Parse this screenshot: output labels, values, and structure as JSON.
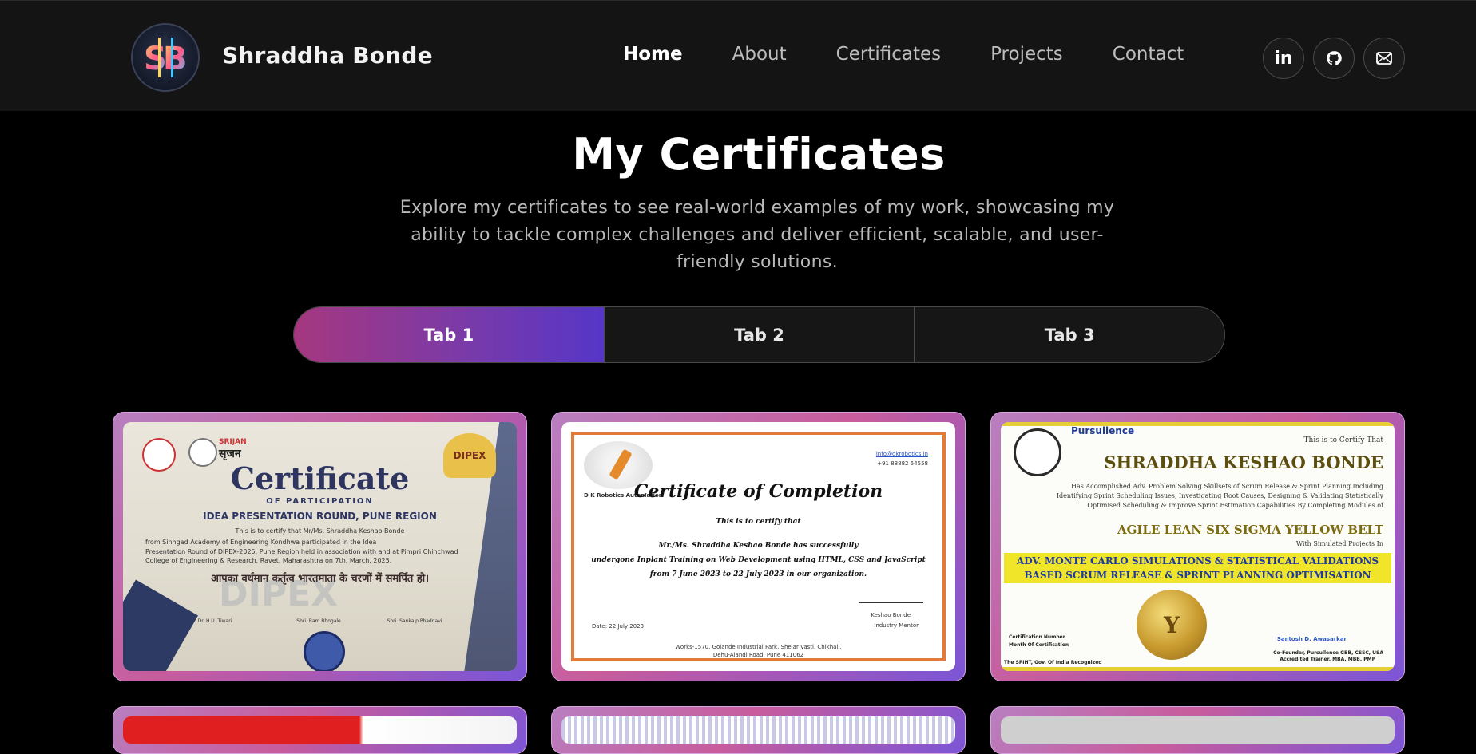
{
  "header": {
    "brand": "Shraddha Bonde",
    "logo_initials": "SB",
    "nav": [
      {
        "label": "Home",
        "active": true
      },
      {
        "label": "About",
        "active": false
      },
      {
        "label": "Certificates",
        "active": false
      },
      {
        "label": "Projects",
        "active": false
      },
      {
        "label": "Contact",
        "active": false
      }
    ],
    "social": [
      {
        "icon": "linkedin-icon",
        "glyph": "in"
      },
      {
        "icon": "github-icon"
      },
      {
        "icon": "mail-icon"
      }
    ]
  },
  "hero": {
    "title": "My Certificates",
    "description": "Explore my certificates to see real-world examples of my work, showcasing my ability to tackle complex challenges and deliver efficient, scalable, and user-friendly solutions."
  },
  "tabs": [
    {
      "label": "Tab 1",
      "active": true
    },
    {
      "label": "Tab 2",
      "active": false
    },
    {
      "label": "Tab 3",
      "active": false
    }
  ],
  "certificates": [
    {
      "heading": "Certificate",
      "subheading": "OF PARTICIPATION",
      "event": "IDEA PRESENTATION ROUND, PUNE REGION",
      "brand_left": "SRIJAN",
      "brand_left_hindi": "सृजन",
      "brand_right": "DIPEX",
      "recipient_line": "This is to certify that Mr/Ms.  Shraddha Keshao Bonde",
      "college_line": "from  Sinhgad Academy of Engineering Kondhwa  participated in the Idea",
      "detail_line1": "Presentation Round of DIPEX-2025, Pune Region held in association with and at Pimpri Chinchwad",
      "detail_line2": "College of Engineering & Research, Ravet, Maharashtra on 7th, March, 2025.",
      "hindi": "आपका वर्धमान कर्तृत्व भारतमाता के चरणों में समर्पित हो।",
      "watermark": "DIPEX",
      "signatories": [
        "Dr. H.U. Tiwari",
        "Shri. Ram Bhogale",
        "Shri. Sankalp Phadnavi"
      ]
    },
    {
      "heading": "Certificate of Completion",
      "intro": "This is to certify that",
      "body1": "Mr./Ms.  Shraddha Keshao Bonde  has successfully",
      "body2": "undergone Inplant Training on Web Development using HTML, CSS and JavaScript",
      "body3": "from 7 June 2023 to 22 July 2023 in our organization.",
      "company": "D K Robotics Automation",
      "email": "info@dkrobotics.in",
      "phone": "+91 88882 54558",
      "date": "Date: 22 July 2023",
      "signer": "Keshao Bonde",
      "signer_title": "Industry Mentor",
      "address1": "Works-1570, Golande Industrial Park, Shelar Vasti, Chikhali,",
      "address2": "Dehu-Alandi Road, Pune 411062"
    },
    {
      "brand": "Pursullence",
      "certify": "This is to Certify That",
      "name": "SHRADDHA KESHAO BONDE",
      "line1": "Has Accomplished Adv. Problem Solving Skillsets of Scrum Release & Sprint Planning Including",
      "line2": "Identifying Sprint Scheduling Issues, Investigating Root Causes, Designing & Validating Statistically",
      "line3": "Optimised Scheduling & Improve Sprint Estimation Capabilities By Completing Modules of",
      "belt": "AGILE LEAN SIX SIGMA YELLOW BELT",
      "with": "With Simulated Projects In",
      "banner1": "ADV. MONTE CARLO SIMULATIONS & STATISTICAL VALIDATIONS",
      "banner2": "BASED SCRUM RELEASE & SPRINT PLANNING OPTIMISATION",
      "medal": "Y",
      "cert_number": "Certification Number",
      "month": "Month Of Certification",
      "signer": "Santosh D. Awasarkar",
      "signer_title": "Co-Founder, Pursullence GBB, CSSC, USA",
      "signer_title2": "Accredited Trainer, MBA, MBB, PMP",
      "footer": "The SPIHT, Gov. Of India Recognized"
    }
  ],
  "colors": {
    "header_bg": "#141414",
    "tab_active_start": "#a6377f",
    "tab_active_end": "#5636c8"
  }
}
